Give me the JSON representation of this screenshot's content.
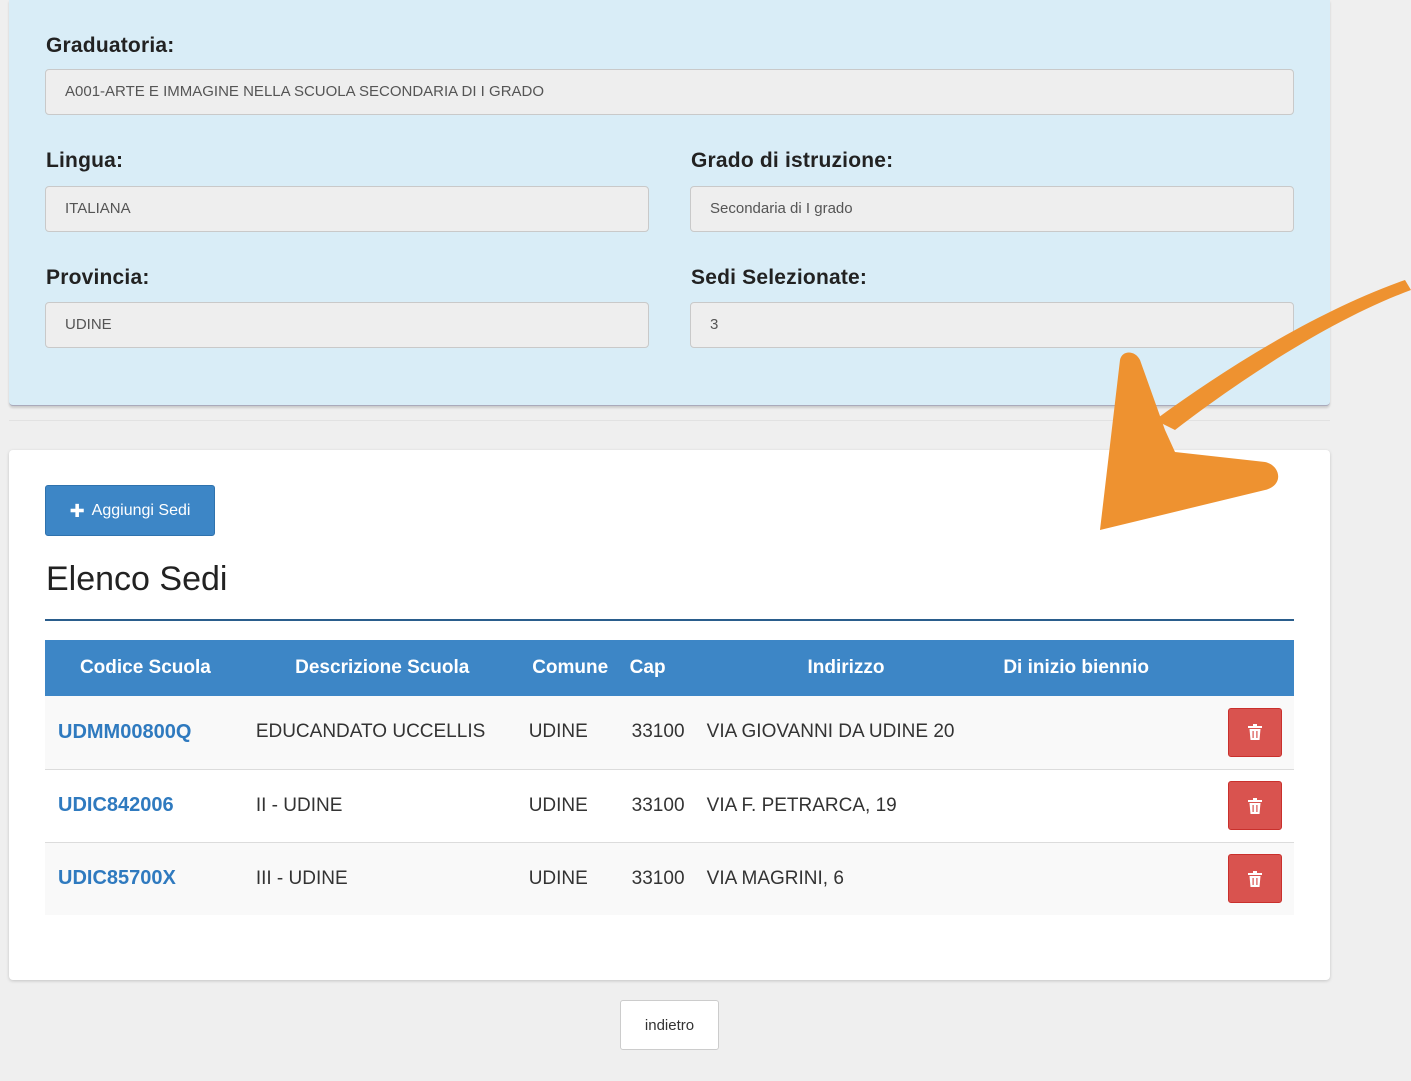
{
  "details": {
    "graduatoria_label": "Graduatoria:",
    "graduatoria_value": "A001-ARTE E IMMAGINE NELLA SCUOLA SECONDARIA DI I GRADO",
    "lingua_label": "Lingua:",
    "lingua_value": "ITALIANA",
    "grado_label": "Grado di istruzione:",
    "grado_value": "Secondaria di I grado",
    "provincia_label": "Provincia:",
    "provincia_value": "UDINE",
    "sedi_label": "Sedi Selezionate:",
    "sedi_value": "3"
  },
  "actions": {
    "add_label": "Aggiungi Sedi",
    "add_icon": "plus-icon",
    "back_label": "indietro"
  },
  "list": {
    "title": "Elenco Sedi",
    "columns": [
      "Codice Scuola",
      "Descrizione Scuola",
      "Comune",
      "Cap",
      "Indirizzo",
      "Di inizio biennio"
    ],
    "rows": [
      {
        "codice": "UDMM00800Q",
        "descrizione": "EDUCANDATO UCCELLIS",
        "comune": "UDINE",
        "cap": "33100",
        "indirizzo": "VIA GIOVANNI DA UDINE 20",
        "biennio": ""
      },
      {
        "codice": "UDIC842006",
        "descrizione": "II - UDINE",
        "comune": "UDINE",
        "cap": "33100",
        "indirizzo": "VIA F. PETRARCA, 19",
        "biennio": ""
      },
      {
        "codice": "UDIC85700X",
        "descrizione": "III - UDINE",
        "comune": "UDINE",
        "cap": "33100",
        "indirizzo": "VIA MAGRINI, 6",
        "biennio": ""
      }
    ],
    "delete_icon": "trash-icon"
  },
  "colors": {
    "info_panel_bg": "#d9edf7",
    "primary": "#3d86c6",
    "danger": "#d9534f",
    "link": "#2f7abf",
    "annotation_arrow": "#ee9230"
  }
}
